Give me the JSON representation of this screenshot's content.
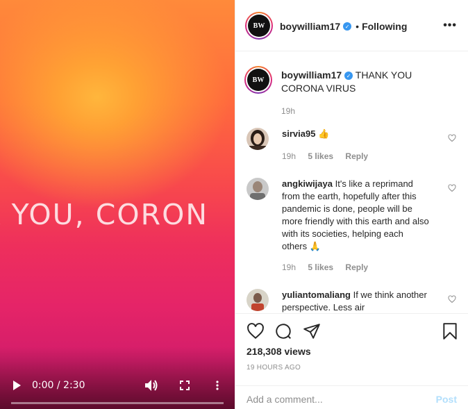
{
  "video": {
    "overlay_text": "NK YOU, CORON",
    "time_display": "0:00 / 2:30",
    "progress": 0
  },
  "header": {
    "username": "boywilliam17",
    "separator": "•",
    "follow_status": "Following",
    "avatar_text": "BW"
  },
  "caption": {
    "username": "boywilliam17",
    "text": "THANK YOU CORONA VIRUS",
    "time": "19h"
  },
  "comments": [
    {
      "username": "sirvia95",
      "text": "👍",
      "time": "19h",
      "likes": "5 likes",
      "reply": "Reply"
    },
    {
      "username": "angkiwijaya",
      "text": "It's like a reprimand from the earth, hopefully after this pandemic is done, people will be more friendly with this earth and also with its societies, helping each others 🙏",
      "time": "19h",
      "likes": "5 likes",
      "reply": "Reply"
    },
    {
      "username": "yuliantomaliang",
      "text": "If we think another perspective. Less air",
      "time": "",
      "likes": "",
      "reply": ""
    }
  ],
  "stats": {
    "views": "218,308 views",
    "posted": "19 HOURS AGO"
  },
  "add_comment": {
    "placeholder": "Add a comment...",
    "post_label": "Post"
  },
  "colors": {
    "verified": "#3897f0",
    "post_disabled": "#b2dffc",
    "muted": "#8e8e8e"
  }
}
